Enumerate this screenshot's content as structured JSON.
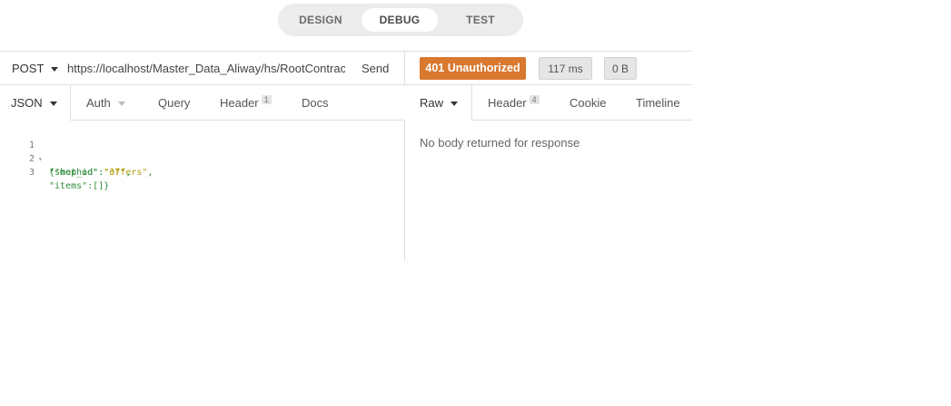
{
  "modes": {
    "design": "DESIGN",
    "debug": "DEBUG",
    "test": "TEST"
  },
  "request": {
    "method": "POST",
    "url": "https://localhost/Master_Data_Aliway/hs/RootContract",
    "send_label": "Send"
  },
  "response": {
    "status": "401 Unauthorized",
    "status_color": "#d9782f",
    "time": "117 ms",
    "size": "0 B",
    "empty_message": "No body returned for response"
  },
  "request_tabs": {
    "body": "JSON",
    "auth": "Auth",
    "query": "Query",
    "header": "Header",
    "header_count": "1",
    "docs": "Docs"
  },
  "response_tabs": {
    "raw": "Raw",
    "header": "Header",
    "header_count": "4",
    "cookie": "Cookie",
    "timeline": "Timeline"
  },
  "editor": {
    "line_numbers": [
      "1",
      "2",
      "3"
    ],
    "lines": [
      {
        "pre": "{",
        "key": "\"method\"",
        "sep": ":",
        "val": "\"offers\"",
        "post": ","
      },
      {
        "pre": "",
        "key": "\"shop_id\"",
        "sep": ":",
        "val": "\"37\"",
        "post": ","
      },
      {
        "pre": "",
        "key": "\"items\"",
        "sep": ":[]}",
        "val": "",
        "post": ""
      }
    ]
  }
}
